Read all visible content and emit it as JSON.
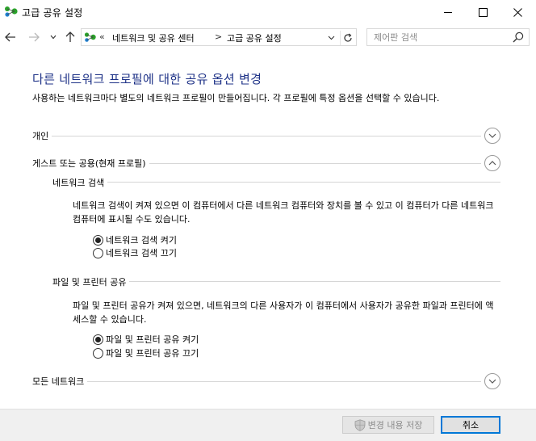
{
  "window": {
    "title": "고급 공유 설정",
    "icon": "network-sharing-icon"
  },
  "titlebar_buttons": [
    "minimize-icon",
    "maximize-icon",
    "close-icon"
  ],
  "address_bar": {
    "overflow": "«",
    "breadcrumbs": [
      "네트워크 및 공유 센터",
      "고급 공유 설정"
    ],
    "separator": ">"
  },
  "search": {
    "placeholder": "제어판 검색",
    "value": ""
  },
  "main": {
    "title": "다른 네트워크 프로필에 대한 공유 옵션 변경",
    "description": "사용하는 네트워크마다 별도의 네트워크 프로필이 만들어집니다. 각 프로필에 특정 옵션을 선택할 수 있습니다.",
    "sections": [
      {
        "label": "개인",
        "expanded": false
      },
      {
        "label": "게스트 또는 공용(현재 프로필)",
        "expanded": true,
        "subsections": [
          {
            "label": "네트워크 검색",
            "description": "네트워크 검색이 켜져 있으면 이 컴퓨터에서 다른 네트워크 컴퓨터와 장치를 볼 수 있고 이 컴퓨터가 다른 네트워크 컴퓨터에 표시될 수도 있습니다.",
            "options": [
              {
                "label": "네트워크 검색 켜기",
                "selected": true
              },
              {
                "label": "네트워크 검색 끄기",
                "selected": false
              }
            ]
          },
          {
            "label": "파일 및 프린터 공유",
            "description": "파일 및 프린터 공유가 켜져 있으면, 네트워크의 다른 사용자가 이 컴퓨터에서 사용자가 공유한 파일과 프린터에 액세스할 수 있습니다.",
            "options": [
              {
                "label": "파일 및 프린터 공유 켜기",
                "selected": true
              },
              {
                "label": "파일 및 프린터 공유 끄기",
                "selected": false
              }
            ]
          }
        ]
      },
      {
        "label": "모든 네트워크",
        "expanded": false
      }
    ]
  },
  "footer": {
    "save_label": "변경 내용 저장",
    "save_enabled": false,
    "cancel_label": "취소"
  },
  "colors": {
    "title_blue": "#1e3287",
    "accent": "#0078d7",
    "footer_bg": "#f0f0f0"
  }
}
